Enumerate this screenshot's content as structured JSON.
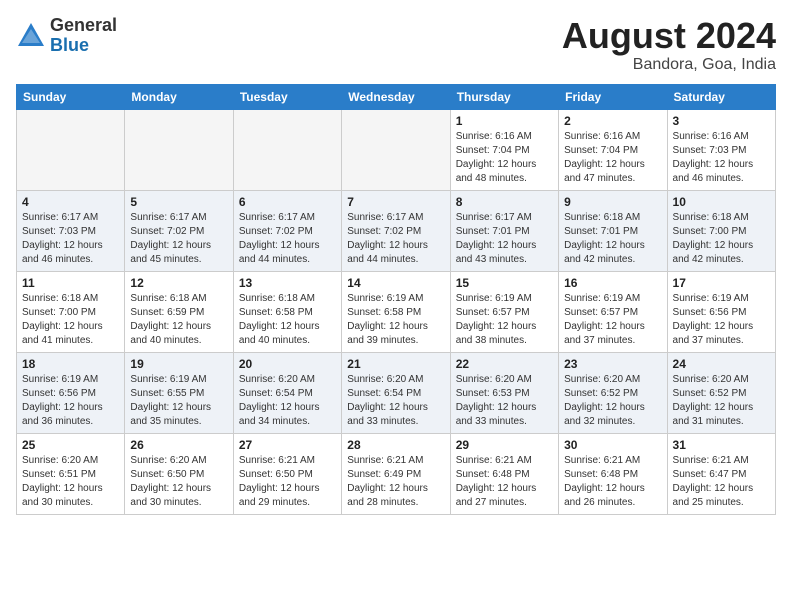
{
  "header": {
    "logo_general": "General",
    "logo_blue": "Blue",
    "month_year": "August 2024",
    "location": "Bandora, Goa, India"
  },
  "calendar": {
    "days_of_week": [
      "Sunday",
      "Monday",
      "Tuesday",
      "Wednesday",
      "Thursday",
      "Friday",
      "Saturday"
    ],
    "weeks": [
      [
        {
          "day": "",
          "info": ""
        },
        {
          "day": "",
          "info": ""
        },
        {
          "day": "",
          "info": ""
        },
        {
          "day": "",
          "info": ""
        },
        {
          "day": "1",
          "info": "Sunrise: 6:16 AM\nSunset: 7:04 PM\nDaylight: 12 hours\nand 48 minutes."
        },
        {
          "day": "2",
          "info": "Sunrise: 6:16 AM\nSunset: 7:04 PM\nDaylight: 12 hours\nand 47 minutes."
        },
        {
          "day": "3",
          "info": "Sunrise: 6:16 AM\nSunset: 7:03 PM\nDaylight: 12 hours\nand 46 minutes."
        }
      ],
      [
        {
          "day": "4",
          "info": "Sunrise: 6:17 AM\nSunset: 7:03 PM\nDaylight: 12 hours\nand 46 minutes."
        },
        {
          "day": "5",
          "info": "Sunrise: 6:17 AM\nSunset: 7:02 PM\nDaylight: 12 hours\nand 45 minutes."
        },
        {
          "day": "6",
          "info": "Sunrise: 6:17 AM\nSunset: 7:02 PM\nDaylight: 12 hours\nand 44 minutes."
        },
        {
          "day": "7",
          "info": "Sunrise: 6:17 AM\nSunset: 7:02 PM\nDaylight: 12 hours\nand 44 minutes."
        },
        {
          "day": "8",
          "info": "Sunrise: 6:17 AM\nSunset: 7:01 PM\nDaylight: 12 hours\nand 43 minutes."
        },
        {
          "day": "9",
          "info": "Sunrise: 6:18 AM\nSunset: 7:01 PM\nDaylight: 12 hours\nand 42 minutes."
        },
        {
          "day": "10",
          "info": "Sunrise: 6:18 AM\nSunset: 7:00 PM\nDaylight: 12 hours\nand 42 minutes."
        }
      ],
      [
        {
          "day": "11",
          "info": "Sunrise: 6:18 AM\nSunset: 7:00 PM\nDaylight: 12 hours\nand 41 minutes."
        },
        {
          "day": "12",
          "info": "Sunrise: 6:18 AM\nSunset: 6:59 PM\nDaylight: 12 hours\nand 40 minutes."
        },
        {
          "day": "13",
          "info": "Sunrise: 6:18 AM\nSunset: 6:58 PM\nDaylight: 12 hours\nand 40 minutes."
        },
        {
          "day": "14",
          "info": "Sunrise: 6:19 AM\nSunset: 6:58 PM\nDaylight: 12 hours\nand 39 minutes."
        },
        {
          "day": "15",
          "info": "Sunrise: 6:19 AM\nSunset: 6:57 PM\nDaylight: 12 hours\nand 38 minutes."
        },
        {
          "day": "16",
          "info": "Sunrise: 6:19 AM\nSunset: 6:57 PM\nDaylight: 12 hours\nand 37 minutes."
        },
        {
          "day": "17",
          "info": "Sunrise: 6:19 AM\nSunset: 6:56 PM\nDaylight: 12 hours\nand 37 minutes."
        }
      ],
      [
        {
          "day": "18",
          "info": "Sunrise: 6:19 AM\nSunset: 6:56 PM\nDaylight: 12 hours\nand 36 minutes."
        },
        {
          "day": "19",
          "info": "Sunrise: 6:19 AM\nSunset: 6:55 PM\nDaylight: 12 hours\nand 35 minutes."
        },
        {
          "day": "20",
          "info": "Sunrise: 6:20 AM\nSunset: 6:54 PM\nDaylight: 12 hours\nand 34 minutes."
        },
        {
          "day": "21",
          "info": "Sunrise: 6:20 AM\nSunset: 6:54 PM\nDaylight: 12 hours\nand 33 minutes."
        },
        {
          "day": "22",
          "info": "Sunrise: 6:20 AM\nSunset: 6:53 PM\nDaylight: 12 hours\nand 33 minutes."
        },
        {
          "day": "23",
          "info": "Sunrise: 6:20 AM\nSunset: 6:52 PM\nDaylight: 12 hours\nand 32 minutes."
        },
        {
          "day": "24",
          "info": "Sunrise: 6:20 AM\nSunset: 6:52 PM\nDaylight: 12 hours\nand 31 minutes."
        }
      ],
      [
        {
          "day": "25",
          "info": "Sunrise: 6:20 AM\nSunset: 6:51 PM\nDaylight: 12 hours\nand 30 minutes."
        },
        {
          "day": "26",
          "info": "Sunrise: 6:20 AM\nSunset: 6:50 PM\nDaylight: 12 hours\nand 30 minutes."
        },
        {
          "day": "27",
          "info": "Sunrise: 6:21 AM\nSunset: 6:50 PM\nDaylight: 12 hours\nand 29 minutes."
        },
        {
          "day": "28",
          "info": "Sunrise: 6:21 AM\nSunset: 6:49 PM\nDaylight: 12 hours\nand 28 minutes."
        },
        {
          "day": "29",
          "info": "Sunrise: 6:21 AM\nSunset: 6:48 PM\nDaylight: 12 hours\nand 27 minutes."
        },
        {
          "day": "30",
          "info": "Sunrise: 6:21 AM\nSunset: 6:48 PM\nDaylight: 12 hours\nand 26 minutes."
        },
        {
          "day": "31",
          "info": "Sunrise: 6:21 AM\nSunset: 6:47 PM\nDaylight: 12 hours\nand 25 minutes."
        }
      ]
    ]
  }
}
